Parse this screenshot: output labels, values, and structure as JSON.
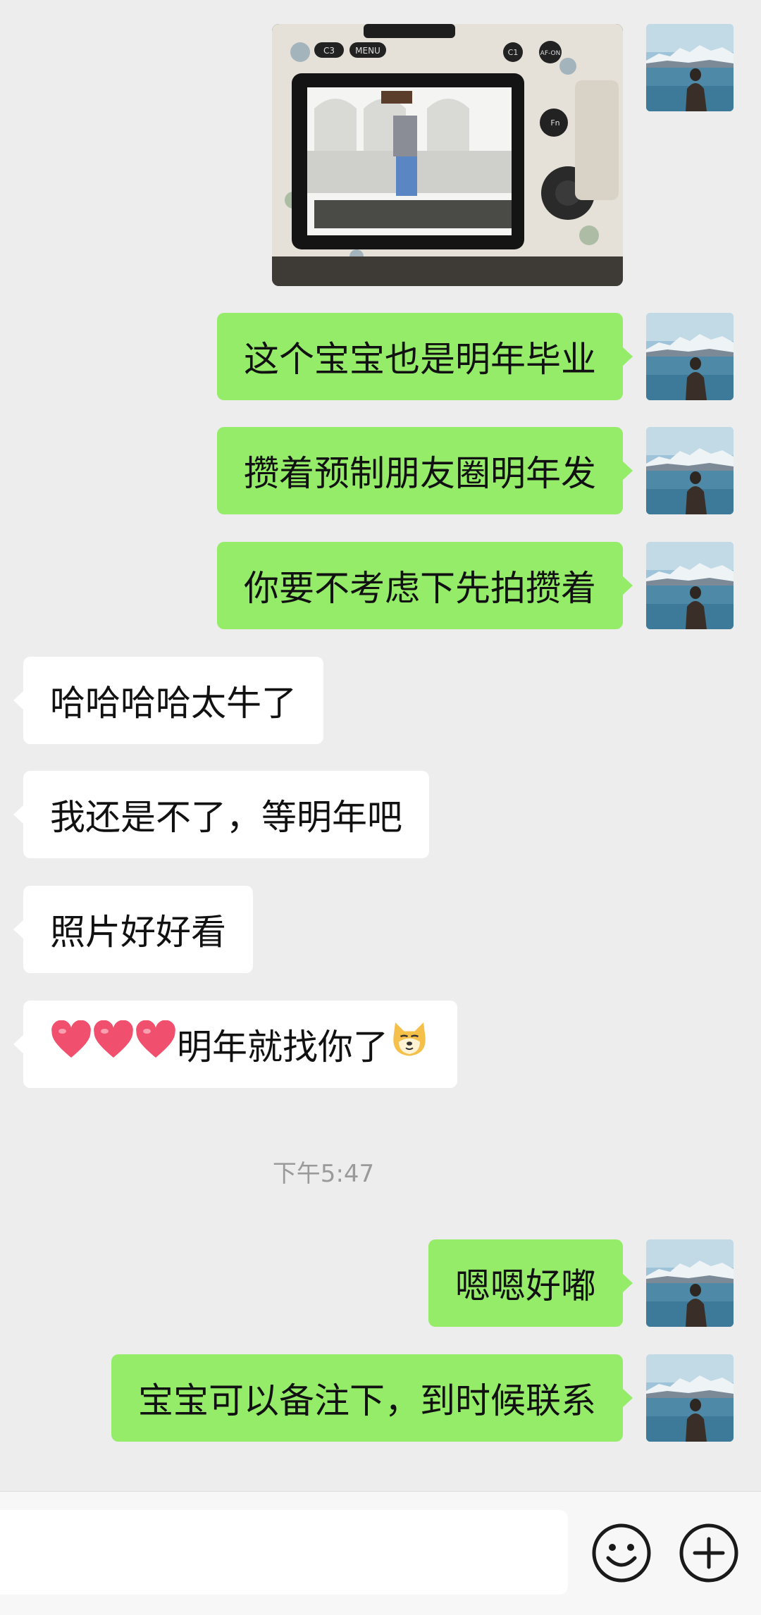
{
  "chat": {
    "messages": [
      {
        "type": "image",
        "side": "out",
        "description": "camera back screen photo"
      },
      {
        "type": "text",
        "side": "out",
        "text": "这个宝宝也是明年毕业"
      },
      {
        "type": "text",
        "side": "out",
        "text": "攒着预制朋友圈明年发"
      },
      {
        "type": "text",
        "side": "out",
        "text": "你要不考虑下先拍攒着"
      },
      {
        "type": "text",
        "side": "in",
        "text": "哈哈哈哈太牛了"
      },
      {
        "type": "text",
        "side": "in",
        "text": "我还是不了，等明年吧"
      },
      {
        "type": "text",
        "side": "in",
        "text": "照片好好看"
      },
      {
        "type": "text",
        "side": "in",
        "text": "明年就找你了",
        "emojis": [
          "heart-icon",
          "heart-icon",
          "heart-icon",
          "doge-icon"
        ]
      },
      {
        "type": "time",
        "text": "下午5:47"
      },
      {
        "type": "text",
        "side": "out",
        "text": "嗯嗯好嘟"
      },
      {
        "type": "text",
        "side": "out",
        "text": "宝宝可以备注下，到时候联系"
      }
    ],
    "photo_labels": {
      "menu": "MENU",
      "c1": "C1",
      "c3": "C3",
      "afon": "AF-ON",
      "fn": "Fn"
    }
  },
  "input_bar": {
    "value": "",
    "placeholder": "",
    "icons": [
      "emoji-icon",
      "plus-icon"
    ]
  },
  "colors": {
    "background": "#ededed",
    "outgoing_bubble": "#95ec69",
    "incoming_bubble": "#ffffff",
    "timestamp_text": "#9a9a9a"
  }
}
